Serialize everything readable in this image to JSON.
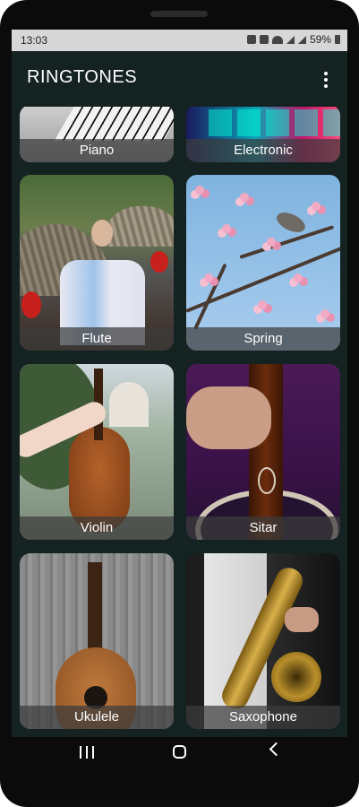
{
  "status_bar": {
    "time": "13:03",
    "battery": "59%"
  },
  "app_bar": {
    "title": "RINGTONES",
    "menu_icon": "more-vert-icon"
  },
  "tiles": [
    {
      "label": "Piano"
    },
    {
      "label": "Electronic"
    },
    {
      "label": "Flute"
    },
    {
      "label": "Spring"
    },
    {
      "label": "Violin"
    },
    {
      "label": "Sitar"
    },
    {
      "label": "Ukulele"
    },
    {
      "label": "Saxophone"
    }
  ],
  "nav_bar": {
    "recents_icon": "recents-icon",
    "home_icon": "home-icon",
    "back_icon": "back-icon"
  },
  "colors": {
    "background": "#142222",
    "status_bar": "#d7d7d7",
    "label_overlay": "#3c3c3c",
    "text": "#ffffff"
  }
}
